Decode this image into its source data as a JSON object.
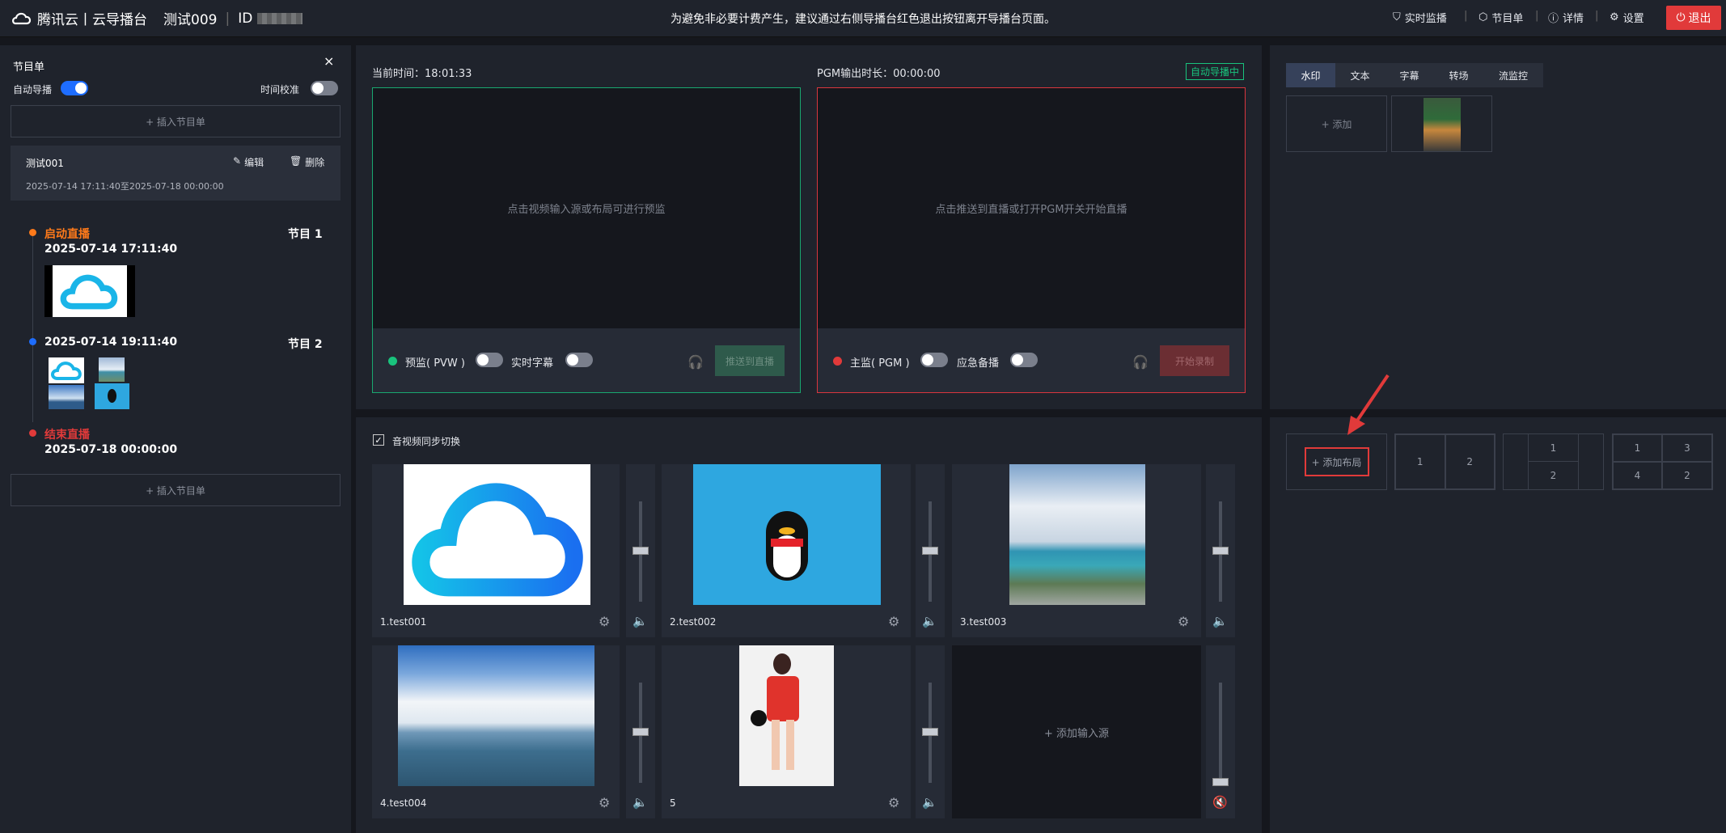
{
  "topbar": {
    "brand": "腾讯云丨云导播台",
    "title": "测试009",
    "id_label": "ID",
    "notice": "为避免非必要计费产生，建议通过右侧导播台红色退出按钮离开导播台页面。",
    "live_monitor": "实时监播",
    "program_list": "节目单",
    "details": "详情",
    "settings": "设置",
    "exit": "退出"
  },
  "left": {
    "title": "节目单",
    "auto_director": "自动导播",
    "time_calibration": "时间校准",
    "insert_program": "+ 插入节目单",
    "program": {
      "name": "测试001",
      "edit": "编辑",
      "delete": "删除",
      "range": "2025-07-14 17:11:40至2025-07-18 00:00:00"
    },
    "timeline": [
      {
        "label": "启动直播",
        "time": "2025-07-14 17:11:40",
        "section": "节目 1"
      },
      {
        "label": "",
        "time": "2025-07-14 19:11:40",
        "section": "节目 2"
      },
      {
        "label": "结束直播",
        "time": "2025-07-18 00:00:00",
        "section": ""
      }
    ]
  },
  "preview": {
    "current_time_label": "当前时间：",
    "current_time": "18:01:33",
    "placeholder": "点击视频输入源或布局可进行预监",
    "pvw_label": "预监( PVW )",
    "subtitle_label": "实时字幕",
    "push_button": "推送到直播"
  },
  "program_out": {
    "duration_label": "PGM输出时长：",
    "duration": "00:00:00",
    "auto_badge": "自动导播中",
    "placeholder": "点击推送到直播或打开PGM开关开始直播",
    "pgm_label": "主监( PGM )",
    "backup_label": "应急备播",
    "record_button": "开始录制"
  },
  "sources": {
    "sync_label": "音视频同步切换",
    "items": [
      {
        "name": "1.test001"
      },
      {
        "name": "2.test002"
      },
      {
        "name": "3.test003"
      },
      {
        "name": "4.test004"
      },
      {
        "name": "5"
      }
    ],
    "add_source": "+ 添加输入源"
  },
  "right": {
    "tabs": [
      "水印",
      "文本",
      "字幕",
      "转场",
      "流监控"
    ],
    "add": "+ 添加",
    "add_layout": "+ 添加布局",
    "layout2": [
      "1",
      "2"
    ],
    "layout3": [
      "1",
      "2"
    ],
    "layout4": [
      "1",
      "3",
      "4",
      "2"
    ]
  },
  "colors": {
    "accent": "#1e6dff",
    "pvw": "#19c37d",
    "pgm": "#e13a3a",
    "exit": "#e13a3a"
  }
}
